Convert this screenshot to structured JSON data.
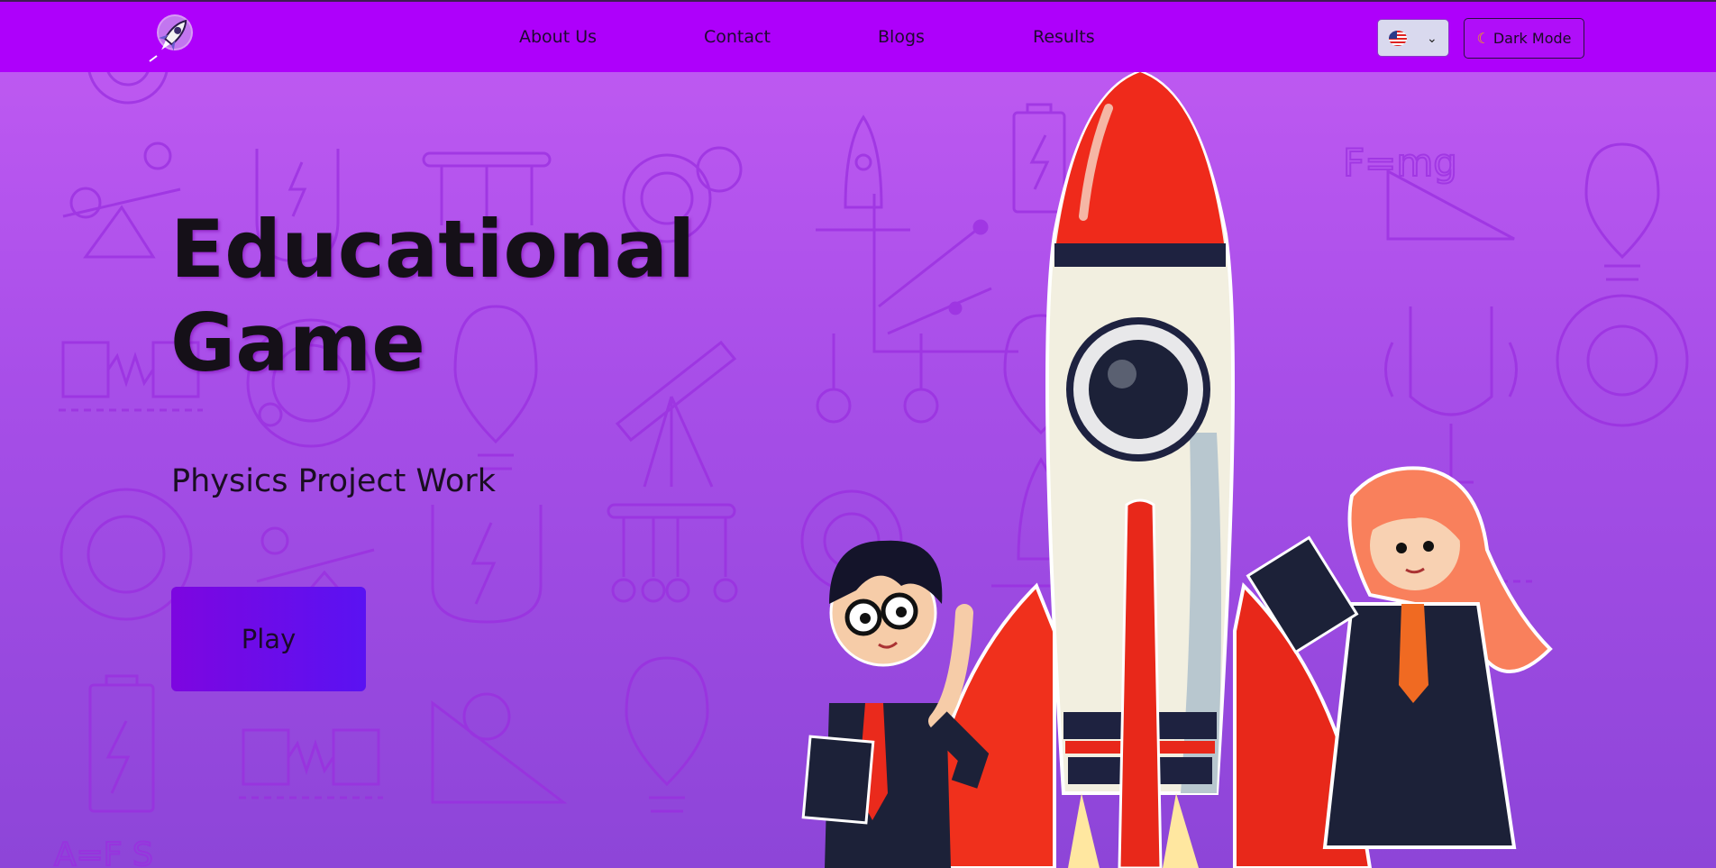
{
  "nav": {
    "links": [
      "About Us",
      "Contact",
      "Blogs",
      "Results"
    ],
    "language": "en-US",
    "dark_mode_label": "Dark Mode",
    "dark_mode_icon": "moon-icon"
  },
  "hero": {
    "title_line1": "Educational",
    "title_line2": "Game",
    "subtitle": "Physics Project Work",
    "play_label": "Play"
  },
  "colors": {
    "navbar": "#ae00fb",
    "background": "#b050ee",
    "play_button": "#6a0cea"
  }
}
